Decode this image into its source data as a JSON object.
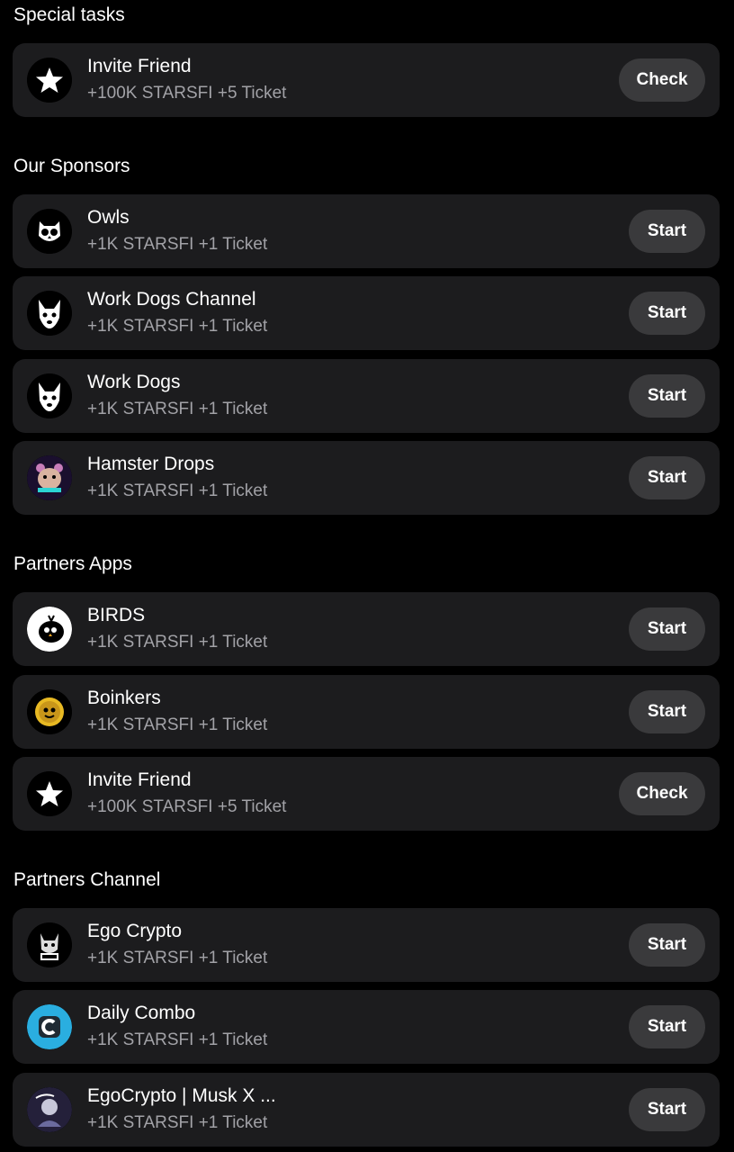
{
  "sections": {
    "special": "Special tasks",
    "sponsors": "Our Sponsors",
    "apps": "Partners Apps",
    "channel": "Partners Channel"
  },
  "tasks": [
    {
      "title": "Invite Friend",
      "reward": "+100K STARSFI +5 Ticket",
      "button": "Check",
      "icon": "star-icon"
    },
    {
      "title": "Owls",
      "reward": "+1K STARSFI +1 Ticket",
      "button": "Start",
      "icon": "owl-icon"
    },
    {
      "title": "Work Dogs Channel",
      "reward": "+1K STARSFI +1 Ticket",
      "button": "Start",
      "icon": "dog-icon"
    },
    {
      "title": "Work Dogs",
      "reward": "+1K STARSFI +1 Ticket",
      "button": "Start",
      "icon": "dog-icon"
    },
    {
      "title": "Hamster Drops",
      "reward": "+1K STARSFI +1 Ticket",
      "button": "Start",
      "icon": "hamster-icon"
    },
    {
      "title": "BIRDS",
      "reward": "+1K STARSFI +1 Ticket",
      "button": "Start",
      "icon": "bird-icon"
    },
    {
      "title": "Boinkers",
      "reward": "+1K STARSFI +1 Ticket",
      "button": "Start",
      "icon": "coin-icon"
    },
    {
      "title": "Invite Friend",
      "reward": "+100K STARSFI +5 Ticket",
      "button": "Check",
      "icon": "star-icon"
    },
    {
      "title": "Ego Crypto",
      "reward": "+1K STARSFI +1 Ticket",
      "button": "Start",
      "icon": "ego-icon"
    },
    {
      "title": "Daily Combo",
      "reward": "+1K STARSFI +1 Ticket",
      "button": "Start",
      "icon": "combo-icon"
    },
    {
      "title": "EgoCrypto | Musk X ...",
      "reward": "+1K STARSFI +1 Ticket",
      "button": "Start",
      "icon": "musk-icon"
    }
  ],
  "colors": {
    "background": "#000000",
    "card": "#1c1c1e",
    "button": "#3a3a3c",
    "reward_text": "#a2a2a7"
  }
}
